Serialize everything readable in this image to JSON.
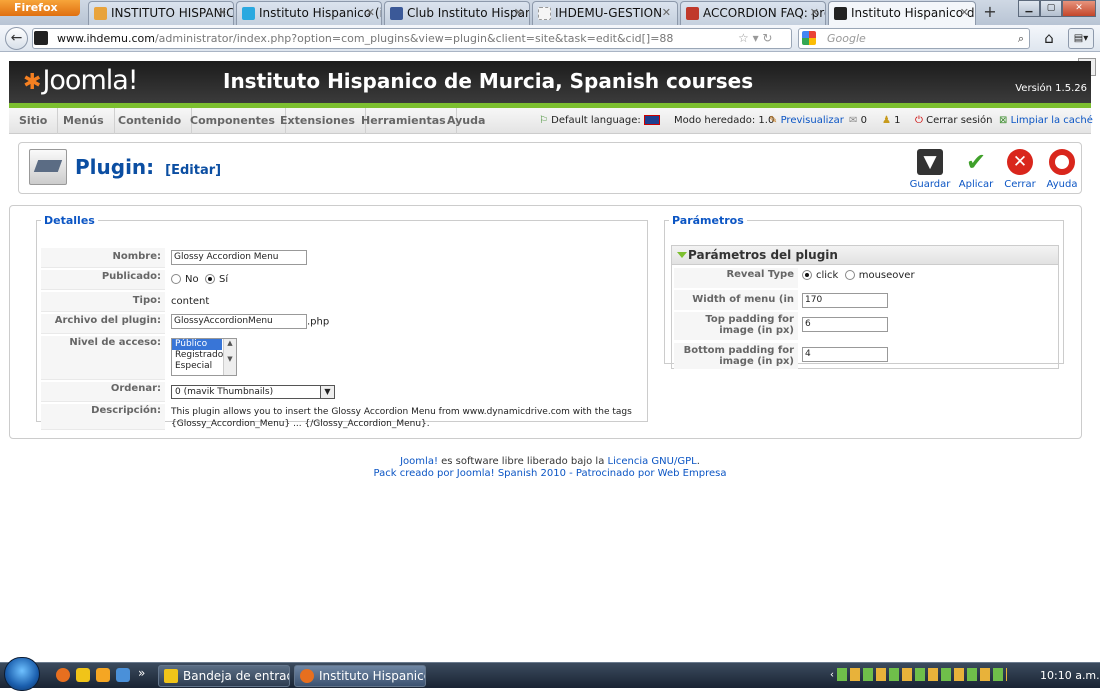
{
  "browser": {
    "app_button": "Firefox",
    "tabs": [
      {
        "title": "INSTITUTO HISPANIC...",
        "icon_color": "#e8a33c"
      },
      {
        "title": "Instituto Hispanico (ih...",
        "icon_color": "#2aa9e0"
      },
      {
        "title": "Club Instituto Hispanic...",
        "icon_color": "#3b5998"
      },
      {
        "title": "IHDEMU-GESTION",
        "icon_color": "#dddddd"
      },
      {
        "title": "ACCORDION FAQ: pro...",
        "icon_color": "#c0392b"
      },
      {
        "title": "Instituto Hispanico de ...",
        "icon_color": "#222222"
      }
    ],
    "url_domain": "www.ihdemu.com",
    "url_path": "/administrator/index.php?option=com_plugins&view=plugin&client=site&task=edit&cid[]=88",
    "search_placeholder": "Google"
  },
  "header": {
    "logo_text": "Joomla!",
    "site_title": "Instituto Hispanico de Murcia, Spanish courses",
    "version": "Versión 1.5.26"
  },
  "menu": [
    "Sitio",
    "Menús",
    "Contenido",
    "Componentes",
    "Extensiones",
    "Herramientas",
    "Ayuda"
  ],
  "status": {
    "default_language": "Default language:",
    "mode": "Modo heredado: 1.0",
    "preview": "Previsualizar",
    "messages_count": "0",
    "users_count": "1",
    "logout": "Cerrar sesión",
    "clear_cache": "Limpiar la caché"
  },
  "toolbar": {
    "title": "Plugin:",
    "subtitle": "[Editar]",
    "buttons": {
      "save": "Guardar",
      "apply": "Aplicar",
      "close": "Cerrar",
      "help": "Ayuda"
    }
  },
  "details": {
    "legend": "Detalles",
    "name_label": "Nombre:",
    "name_value": "Glossy Accordion Menu",
    "published_label": "Publicado:",
    "published_no": "No",
    "published_yes": "Sí",
    "type_label": "Tipo:",
    "type_value": "content",
    "file_label": "Archivo del plugin:",
    "file_value": "GlossyAccordionMenu",
    "file_ext": ".php",
    "access_label": "Nivel de acceso:",
    "access_options": [
      "Público",
      "Registrado",
      "Especial"
    ],
    "order_label": "Ordenar:",
    "order_value": "0 (mavik Thumbnails)",
    "description_label": "Descripción:",
    "description_line1": "This plugin allows you to insert the Glossy Accordion Menu from www.dynamicdrive.com with the tags",
    "description_line2": "{Glossy_Accordion_Menu} ... {/Glossy_Accordion_Menu}."
  },
  "params": {
    "legend": "Parámetros",
    "panel_title": "Parámetros del plugin",
    "reveal_label": "Reveal Type",
    "reveal_click": "click",
    "reveal_mouseover": "mouseover",
    "width_label": "Width of menu (in px)",
    "width_value": "170",
    "top_label": "Top padding for image (in px)",
    "top_value": "6",
    "bottom_label": "Bottom padding for image (in px)",
    "bottom_value": "4"
  },
  "footer": {
    "line1_link": "Joomla!",
    "line1_text": " es software libre liberado bajo la ",
    "line1_license": "Licencia GNU/GPL",
    "line1_end": ".",
    "line2": "Pack creado por Joomla! Spanish 2010 - Patrocinado por Web Empresa"
  },
  "taskbar": {
    "items": [
      "Bandeja de entrada ...",
      "Instituto Hispanico ..."
    ],
    "clock": "10:10 a.m."
  }
}
